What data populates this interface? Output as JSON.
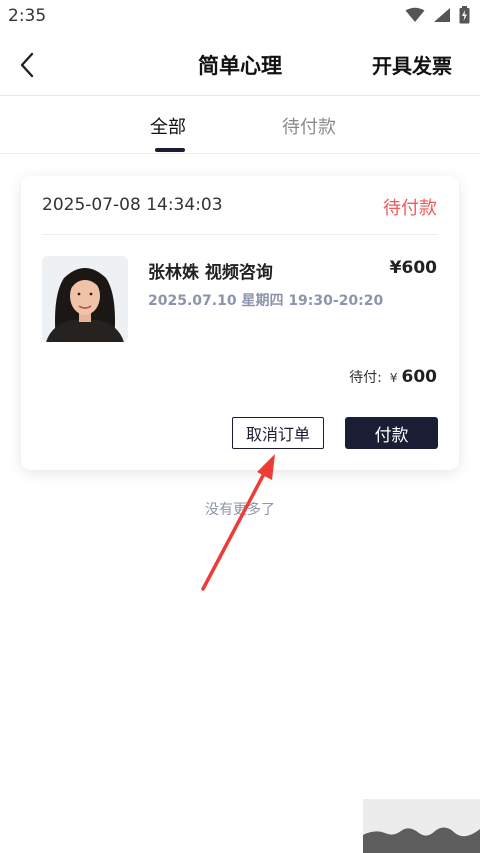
{
  "status_bar": {
    "time": "2:35"
  },
  "nav": {
    "title": "简单心理",
    "action": "开具发票"
  },
  "tabs": [
    {
      "label": "全部"
    },
    {
      "label": "待付款"
    }
  ],
  "order": {
    "created_at": "2025-07-08 14:34:03",
    "status": "待付款",
    "item_title": "张林姝 视频咨询",
    "price": "¥600",
    "schedule": "2025.07.10 星期四 19:30-20:20",
    "due_label": "待付:",
    "due_currency": "¥",
    "due_amount": "600",
    "cancel_label": "取消订单",
    "pay_label": "付款"
  },
  "footer": {
    "no_more": "没有更多了"
  },
  "colors": {
    "accent": "#1a1d33",
    "status_red": "#ef5a5a",
    "muted_blue": "#8d95ad",
    "arrow_red": "#ee3b36"
  },
  "icons": [
    "wifi-icon",
    "signal-icon",
    "battery-icon",
    "back-arrow-icon"
  ]
}
